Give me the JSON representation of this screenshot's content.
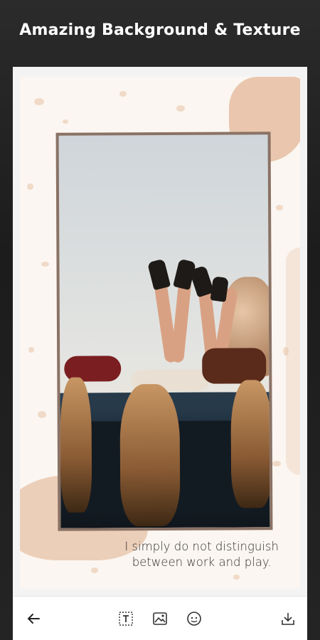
{
  "headline": "Amazing Background & Texture",
  "quote": {
    "line1": "I simply do not distinguish",
    "line2": "between work and play."
  },
  "toolbar": {
    "back": "back-arrow-icon",
    "text": "text-box-icon",
    "image": "image-icon",
    "sticker": "sticker-icon",
    "save": "download-icon"
  },
  "colors": {
    "texture_accent": "#e3b595",
    "frame": "#8a7265",
    "text": "#2f2f2f"
  }
}
